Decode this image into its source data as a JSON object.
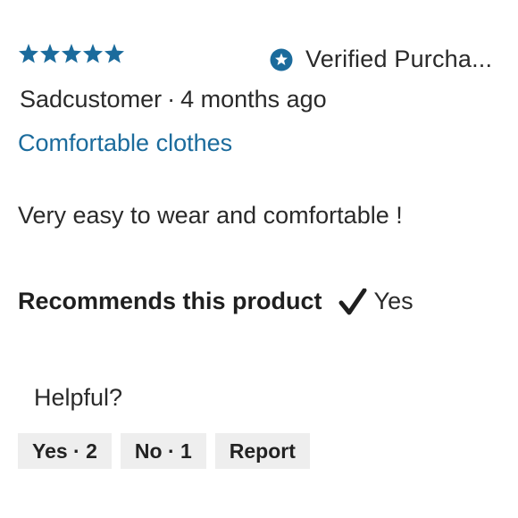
{
  "review": {
    "rating": 5,
    "max_rating": 5,
    "star_color": "#1b6b9c",
    "verified_label": "Verified Purcha...",
    "author": "Sadcustomer",
    "separator": "·",
    "time_ago": "4 months ago",
    "title": "Comfortable clothes",
    "body": "Very easy to wear and comfortable !",
    "recommend_label": "Recommends this product",
    "recommend_icon": "checkmark-icon",
    "recommend_value": "Yes"
  },
  "feedback": {
    "helpful_label": "Helpful?",
    "yes_button": "Yes · 2",
    "no_button": "No · 1",
    "report_button": "Report"
  },
  "colors": {
    "accent": "#1b6b9c",
    "button_bg": "#eeeeee"
  }
}
